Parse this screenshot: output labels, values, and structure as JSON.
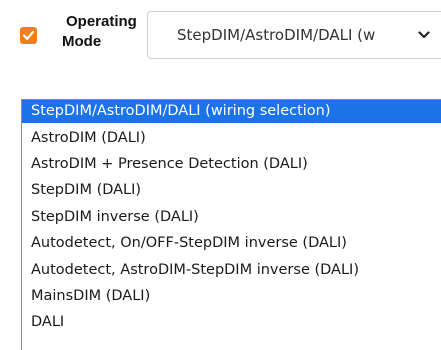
{
  "setting": {
    "checkbox_checked": true,
    "checkbox_color": "#ef7f1a",
    "label_line1": "Operating",
    "label_line2": "Mode",
    "selected_value": "StepDIM/AstroDIM/DALI (w",
    "chevron_icon": "chevron-down-icon"
  },
  "dropdown": {
    "selected_color": "#1a73e8",
    "options": [
      "StepDIM/AstroDIM/DALI (wiring selection)",
      "AstroDIM (DALI)",
      "AstroDIM + Presence Detection (DALI)",
      "StepDIM (DALI)",
      "StepDIM inverse (DALI)",
      "Autodetect, On/OFF-StepDIM inverse (DALI)",
      "Autodetect, AstroDIM-StepDIM inverse (DALI)",
      "MainsDIM (DALI)",
      "DALI"
    ]
  }
}
